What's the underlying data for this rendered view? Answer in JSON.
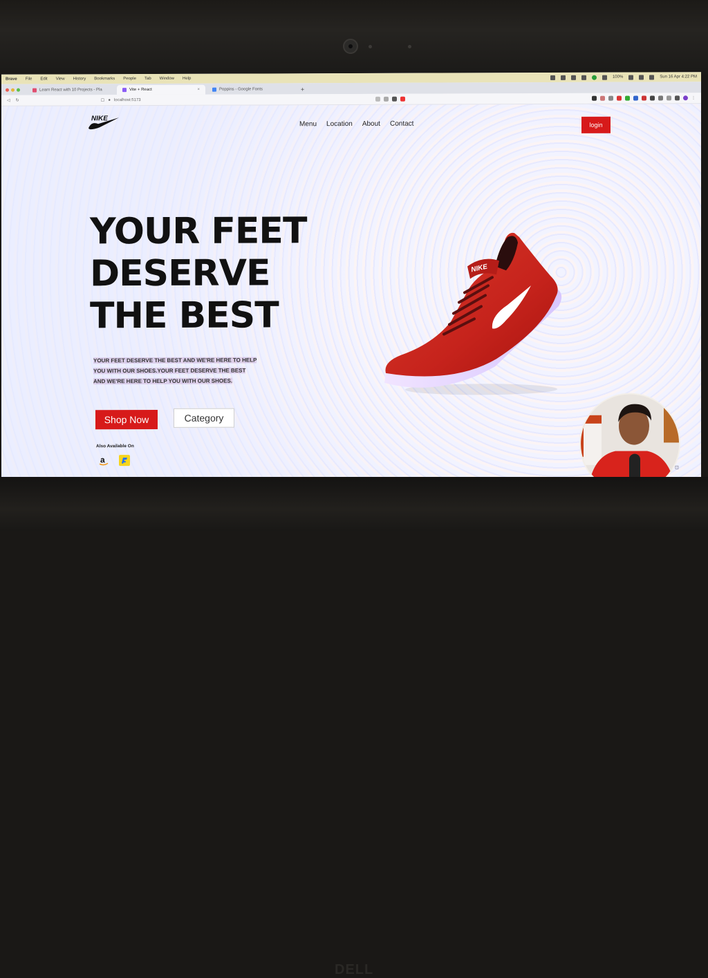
{
  "menubar": {
    "app": "Brave",
    "items": [
      "File",
      "Edit",
      "View",
      "History",
      "Bookmarks",
      "People",
      "Tab",
      "Window",
      "Help"
    ],
    "battery": "100%",
    "clock": "Sun 16 Apr 4:22 PM"
  },
  "tabs": [
    {
      "label": "Learn React with 10 Projects - Pla",
      "favicon_color": "#e04e6f"
    },
    {
      "label": "Vite + React",
      "favicon_color": "#8b5cf6"
    },
    {
      "label": "Poppins - Google Fonts",
      "favicon_color": "#4285f4"
    }
  ],
  "address": {
    "url": "localhost:5173"
  },
  "site": {
    "logo_text": "NIKE",
    "nav": [
      "Menu",
      "Location",
      "About",
      "Contact"
    ],
    "login_label": "login",
    "hero_lines": [
      "YOUR FEET",
      "DESERVE",
      "THE BEST"
    ],
    "hero_sub": "YOUR FEET DESERVE THE BEST AND WE'RE HERE TO HELP YOU WITH OUR SHOES.YOUR FEET DESERVE THE BEST AND WE'RE HERE TO HELP YOU WITH OUR SHOES.",
    "shop_label": "Shop Now",
    "category_label": "Category",
    "also_label": "Also Available On",
    "stores": [
      "amazon-icon",
      "flipkart-icon"
    ]
  },
  "colors": {
    "accent": "#d71a1a",
    "shoe": "#c6231c"
  }
}
